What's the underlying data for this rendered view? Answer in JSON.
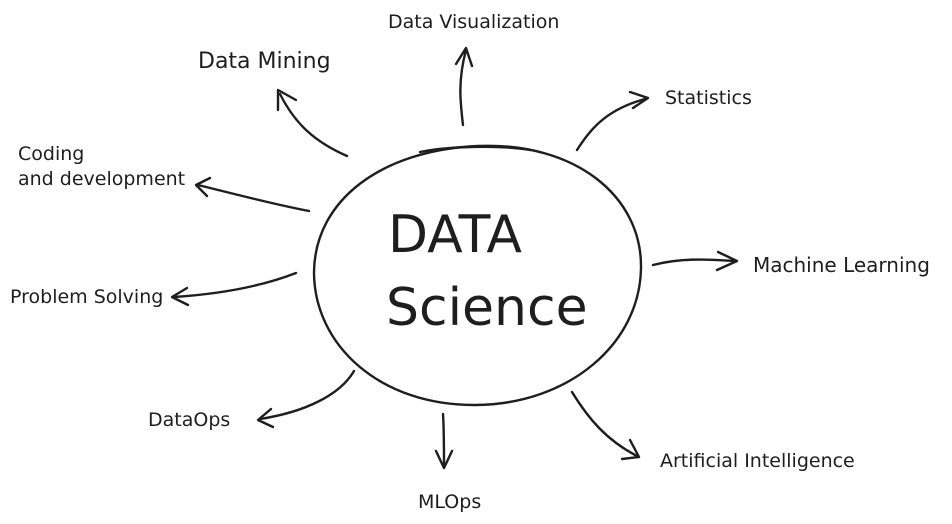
{
  "center": {
    "line1": "DATA",
    "line2": "Science"
  },
  "topics": [
    {
      "id": "data-visualization",
      "label": "Data Visualization"
    },
    {
      "id": "data-mining",
      "label": "Data Mining"
    },
    {
      "id": "statistics",
      "label": "Statistics"
    },
    {
      "id": "coding",
      "label_lines": [
        "Coding",
        "and development"
      ]
    },
    {
      "id": "machine-learning",
      "label": "Machine Learning"
    },
    {
      "id": "problem-solving",
      "label": "Problem Solving"
    },
    {
      "id": "dataops",
      "label": "DataOps"
    },
    {
      "id": "mlops",
      "label": "MLOps"
    },
    {
      "id": "artificial-intelligence",
      "label": "Artificial Intelligence"
    }
  ],
  "colors": {
    "ink": "#1e1e1e",
    "background": "#ffffff"
  }
}
